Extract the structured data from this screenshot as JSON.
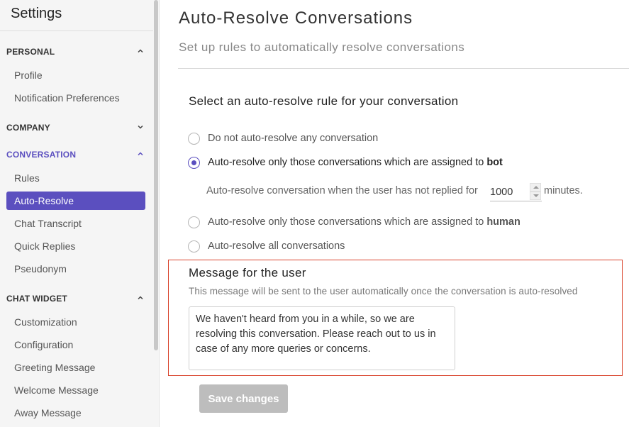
{
  "sidebar": {
    "title": "Settings",
    "sections": {
      "personal": {
        "label": "PERSONAL",
        "items": [
          "Profile",
          "Notification Preferences"
        ]
      },
      "company": {
        "label": "COMPANY"
      },
      "conversation": {
        "label": "CONVERSATION",
        "items": [
          "Rules",
          "Auto-Resolve",
          "Chat Transcript",
          "Quick Replies",
          "Pseudonym"
        ],
        "selected": "Auto-Resolve"
      },
      "chat_widget": {
        "label": "CHAT WIDGET",
        "items": [
          "Customization",
          "Configuration",
          "Greeting Message",
          "Welcome Message",
          "Away Message"
        ]
      }
    }
  },
  "main": {
    "title": "Auto-Resolve Conversations",
    "subtitle": "Set up rules to automatically resolve conversations",
    "rule_heading": "Select an auto-resolve rule for your conversation",
    "options": [
      {
        "text": "Do not auto-resolve any conversation",
        "bold": "",
        "checked": false
      },
      {
        "text": "Auto-resolve only those conversations which are assigned to ",
        "bold": "bot",
        "checked": true
      },
      {
        "text": "Auto-resolve only those conversations which are assigned to ",
        "bold": "human",
        "checked": false
      },
      {
        "text": "Auto-resolve all conversations",
        "bold": "",
        "checked": false
      }
    ],
    "timeout": {
      "prefix": "Auto-resolve conversation when the user has not replied for",
      "value": "1000",
      "suffix": "minutes."
    },
    "message": {
      "title": "Message for the user",
      "description": "This message will be sent to the user automatically once the conversation is auto-resolved",
      "text": "We haven't heard from you in a while, so we are resolving this conversation. Please reach out to us in case of any more queries or concerns."
    },
    "save_label": "Save changes"
  },
  "colors": {
    "accent": "#5b4fbf",
    "highlight_border": "#d9432c",
    "disabled_button": "#bdbdbd"
  }
}
